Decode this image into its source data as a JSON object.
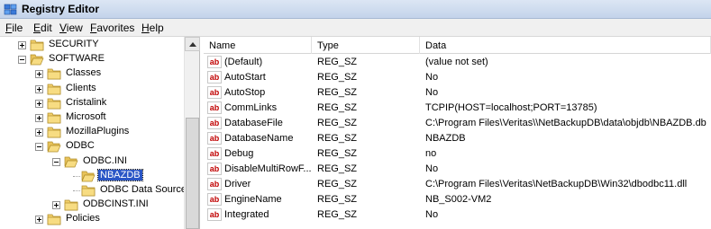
{
  "window": {
    "title": "Registry Editor"
  },
  "menu": [
    {
      "label": "File",
      "acc": "F",
      "rest": "ile"
    },
    {
      "label": "Edit",
      "acc": "E",
      "rest": "dit"
    },
    {
      "label": "View",
      "acc": "V",
      "rest": "iew"
    },
    {
      "label": "Favorites",
      "acc": "F",
      "rest": "avorites"
    },
    {
      "label": "Help",
      "acc": "H",
      "rest": "elp"
    }
  ],
  "tree": {
    "nodes": [
      {
        "label": "SECURITY",
        "expander": "plus",
        "selected": false
      },
      {
        "label": "SOFTWARE",
        "expander": "minus",
        "selected": false
      },
      {
        "label": "Classes",
        "expander": "plus",
        "selected": false
      },
      {
        "label": "Clients",
        "expander": "plus",
        "selected": false
      },
      {
        "label": "Cristalink",
        "expander": "plus",
        "selected": false
      },
      {
        "label": "Microsoft",
        "expander": "plus",
        "selected": false
      },
      {
        "label": "MozillaPlugins",
        "expander": "plus",
        "selected": false
      },
      {
        "label": "ODBC",
        "expander": "minus",
        "selected": false
      },
      {
        "label": "ODBC.INI",
        "expander": "minus",
        "selected": false
      },
      {
        "label": "NBAZDB",
        "expander": "none",
        "selected": true
      },
      {
        "label": "ODBC Data Sources",
        "expander": "none",
        "selected": false
      },
      {
        "label": "ODBCINST.INI",
        "expander": "plus",
        "selected": false
      },
      {
        "label": "Policies",
        "expander": "plus",
        "selected": false
      }
    ]
  },
  "list": {
    "columns": [
      "Name",
      "Type",
      "Data"
    ],
    "rows": [
      {
        "name": "(Default)",
        "type": "REG_SZ",
        "data": "(value not set)"
      },
      {
        "name": "AutoStart",
        "type": "REG_SZ",
        "data": "No"
      },
      {
        "name": "AutoStop",
        "type": "REG_SZ",
        "data": "No"
      },
      {
        "name": "CommLinks",
        "type": "REG_SZ",
        "data": "TCPIP(HOST=localhost;PORT=13785)"
      },
      {
        "name": "DatabaseFile",
        "type": "REG_SZ",
        "data": "C:\\Program Files\\Veritas\\\\NetBackupDB\\data\\objdb\\NBAZDB.db"
      },
      {
        "name": "DatabaseName",
        "type": "REG_SZ",
        "data": "NBAZDB"
      },
      {
        "name": "Debug",
        "type": "REG_SZ",
        "data": "no"
      },
      {
        "name": "DisableMultiRowF...",
        "type": "REG_SZ",
        "data": "No"
      },
      {
        "name": "Driver",
        "type": "REG_SZ",
        "data": "C:\\Program Files\\Veritas\\NetBackupDB\\Win32\\dbodbc11.dll"
      },
      {
        "name": "EngineName",
        "type": "REG_SZ",
        "data": "NB_S002-VM2"
      },
      {
        "name": "Integrated",
        "type": "REG_SZ",
        "data": "No"
      }
    ]
  },
  "icons": {
    "value_icon": "string-value-icon",
    "folder_icon": "folder-icon"
  },
  "colors": {
    "selection": "#2a56c6",
    "value_icon_text": "#c00000"
  }
}
